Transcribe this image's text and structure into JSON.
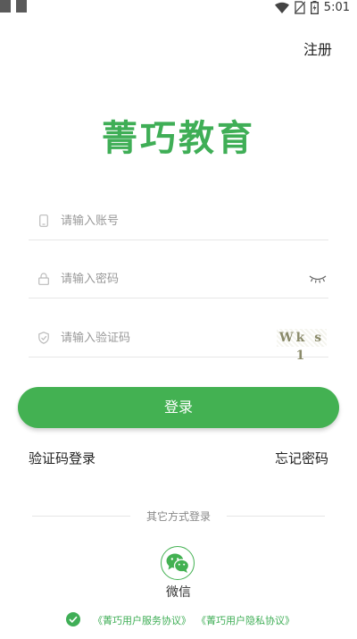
{
  "status_bar": {
    "time": "5:01",
    "icons": [
      "wifi-icon",
      "no-sim-icon",
      "battery-icon"
    ],
    "left_icons": [
      "notification-icon",
      "notification-icon"
    ]
  },
  "header": {
    "register_label": "注册"
  },
  "app": {
    "title": "菁巧教育"
  },
  "form": {
    "account_placeholder": "请输入账号",
    "password_placeholder": "请输入密码",
    "captcha_placeholder": "请输入验证码",
    "captcha_text": "Wk s 1",
    "account_icon": "phone-icon",
    "password_icon": "lock-icon",
    "captcha_icon": "shield-icon",
    "toggle_password_icon": "eye-closed-icon"
  },
  "login_button": {
    "label": "登录"
  },
  "links": {
    "captcha_login": "验证码登录",
    "forgot_password": "忘记密码"
  },
  "other_login": {
    "divider_text": "其它方式登录",
    "wechat_label": "微信",
    "wechat_icon": "wechat-icon"
  },
  "agreement": {
    "service": "《菁巧用户服务协议》",
    "privacy": "《菁巧用户隐私协议》",
    "checked": true
  },
  "colors": {
    "brand_green": "#43b152",
    "title_green": "#3fae56",
    "divider": "#e6e6e6"
  }
}
